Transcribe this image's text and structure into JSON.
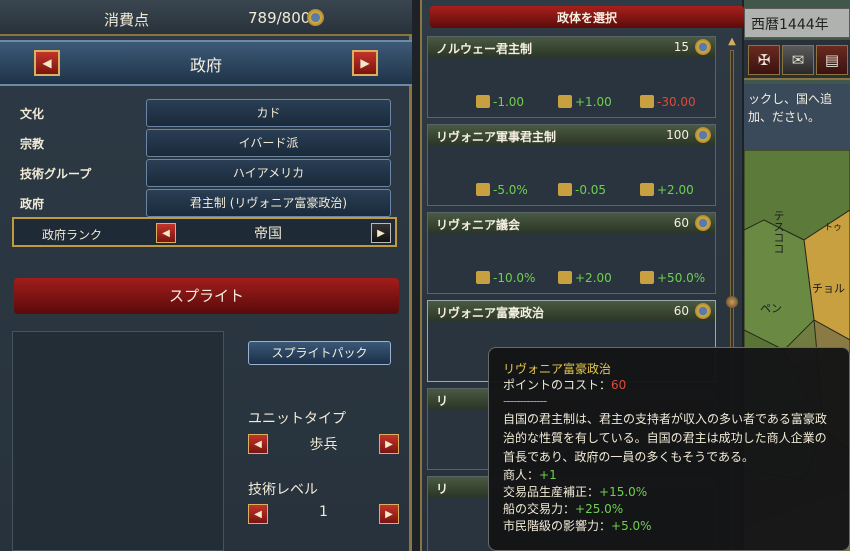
{
  "topbar": {
    "label": "消費点",
    "value": "789/800"
  },
  "government": {
    "title": "政府",
    "fields": [
      {
        "label": "文化",
        "value": "カド"
      },
      {
        "label": "宗教",
        "value": "イバード派"
      },
      {
        "label": "技術グループ",
        "value": "ハイアメリカ"
      },
      {
        "label": "政府",
        "value": "君主制 (リヴォニア富豪政治)"
      }
    ],
    "rank_label": "政府ランク",
    "rank_value": "帝国"
  },
  "sprite": {
    "banner": "スプライト",
    "pack_button": "スプライトパック",
    "unit_type_label": "ユニットタイプ",
    "unit_type_value": "歩兵",
    "tech_level_label": "技術レベル",
    "tech_level_value": "1"
  },
  "gov_list": {
    "header": "政体を選択",
    "cards": [
      {
        "name": "ノルウェー君主制",
        "cost": "15",
        "effects": [
          {
            "text": "-1.00",
            "type": "pos"
          },
          {
            "text": "+1.00",
            "type": "pos"
          },
          {
            "text": "-30.00",
            "type": "neg"
          }
        ]
      },
      {
        "name": "リヴォニア軍事君主制",
        "cost": "100",
        "effects": [
          {
            "text": "-5.0%",
            "type": "pos"
          },
          {
            "text": "-0.05",
            "type": "pos"
          },
          {
            "text": "+2.00",
            "type": "pos"
          }
        ]
      },
      {
        "name": "リヴォニア議会",
        "cost": "60",
        "effects": [
          {
            "text": "-10.0%",
            "type": "pos"
          },
          {
            "text": "+2.00",
            "type": "pos"
          },
          {
            "text": "+50.0%",
            "type": "pos"
          }
        ]
      },
      {
        "name": "リヴォニア富豪政治",
        "cost": "60",
        "effects": []
      },
      {
        "name": "リ",
        "cost": "",
        "effects": []
      },
      {
        "name": "リ",
        "cost": "",
        "effects": []
      }
    ]
  },
  "right": {
    "date": "西暦1444年",
    "message": "ックし、国へ追加、ださい。",
    "map_labels": [
      "テスココ",
      "チョル",
      "トゥ",
      "ペン"
    ]
  },
  "tooltip": {
    "title": "リヴォニア富豪政治",
    "cost_label": "ポイントのコスト：",
    "cost_value": "60",
    "separator": "-------------",
    "description": "自国の君主制は、君主の支持者が収入の多い者である富豪政治的な性質を有している。自国の君主は成功した商人企業の首長であり、政府の一員の多くもそうである。",
    "modifiers": [
      {
        "label": "商人：",
        "value": "+1"
      },
      {
        "label": "交易品生産補正：",
        "value": "+15.0%"
      },
      {
        "label": "船の交易力：",
        "value": "+25.0%"
      },
      {
        "label": "市民階級の影響力：",
        "value": "+5.0%"
      }
    ]
  }
}
